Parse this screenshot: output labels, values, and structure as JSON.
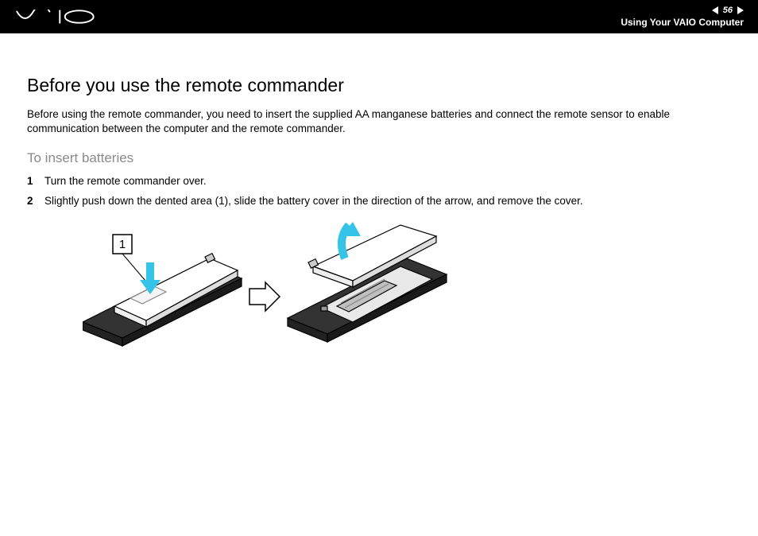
{
  "header": {
    "page_number": "56",
    "section": "Using Your VAIO Computer"
  },
  "content": {
    "title": "Before you use the remote commander",
    "intro": "Before using the remote commander, you need to insert the supplied AA manganese batteries and connect the remote sensor to enable communication between the computer and the remote commander.",
    "subtitle": "To insert batteries",
    "steps": [
      "Turn the remote commander over.",
      "Slightly push down the dented area (1), slide the battery cover in the direction of the arrow, and remove the cover."
    ],
    "figure": {
      "callout_label": "1"
    }
  }
}
